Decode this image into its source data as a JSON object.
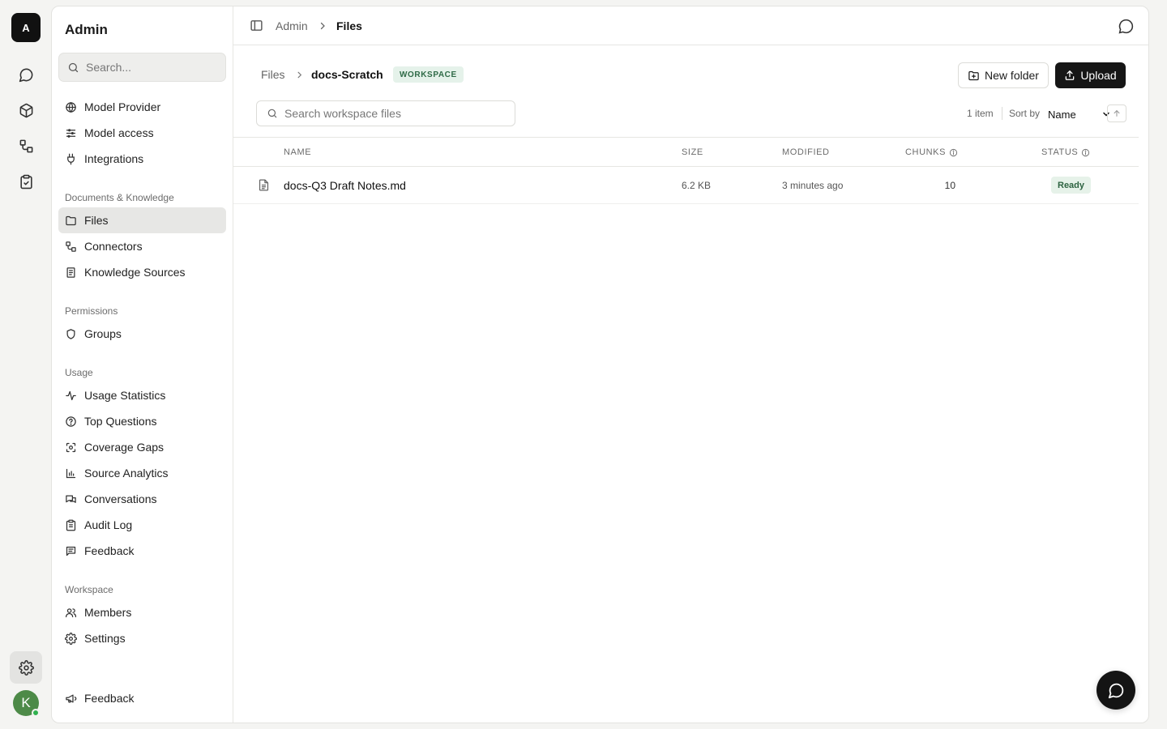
{
  "rail": {
    "logo_letter": "A",
    "avatar_letter": "K",
    "icons": [
      "chat-icon",
      "cube-icon",
      "connectors-icon",
      "clipboard-check-icon",
      "gear-icon"
    ]
  },
  "sidebar": {
    "title": "Admin",
    "search_placeholder": "Search...",
    "items_top": [
      {
        "label": "Model Provider",
        "icon": "globe-icon"
      },
      {
        "label": "Model access",
        "icon": "sliders-icon"
      },
      {
        "label": "Integrations",
        "icon": "plug-icon"
      }
    ],
    "section_docs": "Documents & Knowledge",
    "items_docs": [
      {
        "label": "Files",
        "icon": "folder-icon",
        "active": true
      },
      {
        "label": "Connectors",
        "icon": "connectors-icon"
      },
      {
        "label": "Knowledge Sources",
        "icon": "book-icon"
      }
    ],
    "section_permissions": "Permissions",
    "items_permissions": [
      {
        "label": "Groups",
        "icon": "shield-icon"
      }
    ],
    "section_usage": "Usage",
    "items_usage": [
      {
        "label": "Usage Statistics",
        "icon": "activity-icon"
      },
      {
        "label": "Top Questions",
        "icon": "help-circle-icon"
      },
      {
        "label": "Coverage Gaps",
        "icon": "scan-icon"
      },
      {
        "label": "Source Analytics",
        "icon": "bar-chart-icon"
      },
      {
        "label": "Conversations",
        "icon": "messages-icon"
      },
      {
        "label": "Audit Log",
        "icon": "clipboard-list-icon"
      },
      {
        "label": "Feedback",
        "icon": "message-square-text-icon"
      }
    ],
    "section_workspace": "Workspace",
    "items_workspace": [
      {
        "label": "Members",
        "icon": "users-icon"
      },
      {
        "label": "Settings",
        "icon": "gear-icon"
      }
    ],
    "bottom_feedback": "Feedback"
  },
  "topbar": {
    "crumb_parent": "Admin",
    "crumb_current": "Files"
  },
  "content": {
    "crumb_root": "Files",
    "crumb_folder": "docs-Scratch",
    "badge": "WORKSPACE",
    "new_folder_label": "New folder",
    "upload_label": "Upload",
    "search_placeholder": "Search workspace files",
    "item_count": "1 item",
    "sort_by_label": "Sort by",
    "sort_value": "Name"
  },
  "table": {
    "columns": {
      "name": "NAME",
      "size": "SIZE",
      "modified": "MODIFIED",
      "chunks": "CHUNKS",
      "status": "STATUS"
    },
    "rows": [
      {
        "name": "docs-Q3 Draft Notes.md",
        "size": "6.2 KB",
        "modified": "3 minutes ago",
        "chunks": "10",
        "status": "Ready"
      }
    ]
  },
  "colors": {
    "accent_dark": "#161616",
    "badge_bg": "#e5f2ea",
    "badge_text": "#2f6b47",
    "avatar": "#4d8a48",
    "online": "#2fb14e"
  }
}
